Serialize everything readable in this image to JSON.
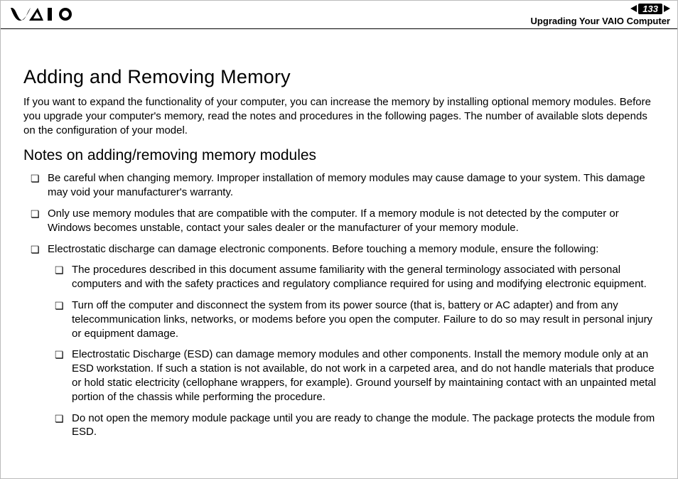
{
  "header": {
    "page_number": "133",
    "breadcrumb": "Upgrading Your VAIO Computer"
  },
  "main": {
    "h1": "Adding and Removing Memory",
    "intro": "If you want to expand the functionality of your computer, you can increase the memory by installing optional memory modules. Before you upgrade your computer's memory, read the notes and procedures in the following pages. The number of available slots depends on the configuration of your model.",
    "h2": "Notes on adding/removing memory modules",
    "bullets": [
      "Be careful when changing memory. Improper installation of memory modules may cause damage to your system. This damage may void your manufacturer's warranty.",
      "Only use memory modules that are compatible with the computer. If a memory module is not detected by the computer or Windows becomes unstable, contact your sales dealer or the manufacturer of your memory module.",
      "Electrostatic discharge can damage electronic components. Before touching a memory module, ensure the following:"
    ],
    "sub_bullets": [
      "The procedures described in this document assume familiarity with the general terminology associated with personal computers and with the safety practices and regulatory compliance required for using and modifying electronic equipment.",
      "Turn off the computer and disconnect the system from its power source (that is, battery or AC adapter) and from any telecommunication links, networks, or modems before you open the computer. Failure to do so may result in personal injury or equipment damage.",
      "Electrostatic Discharge (ESD) can damage memory modules and other components. Install the memory module only at an ESD workstation. If such a station is not available, do not work in a carpeted area, and do not handle materials that produce or hold static electricity (cellophane wrappers, for example). Ground yourself by maintaining contact with an unpainted metal portion of the chassis while performing the procedure.",
      "Do not open the memory module package until you are ready to change the module. The package protects the module from ESD."
    ]
  }
}
